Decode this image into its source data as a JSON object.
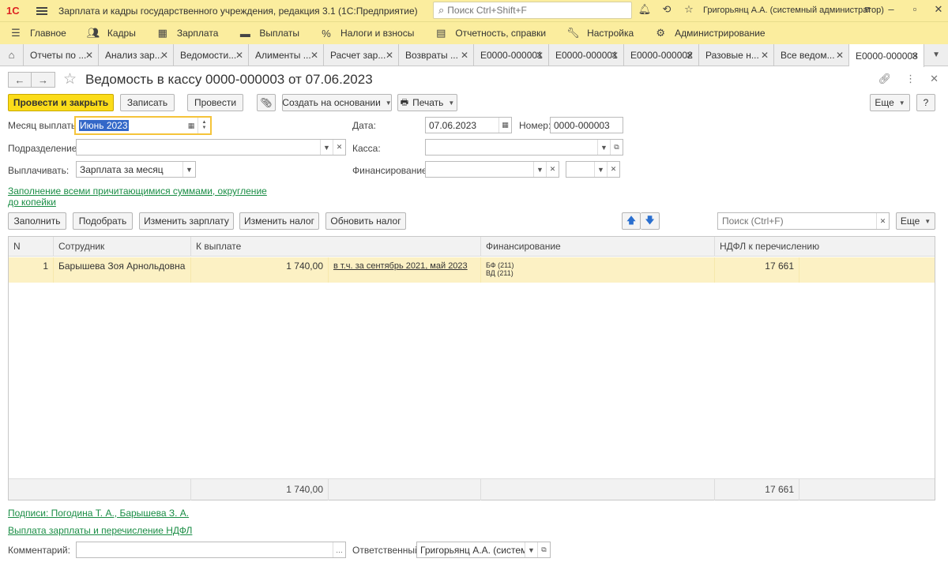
{
  "app": {
    "logo": "1С",
    "title": "Зарплата и кадры государственного учреждения, редакция 3.1  (1С:Предприятие)",
    "search_placeholder": "Поиск Ctrl+Shift+F",
    "user": "Григорьянц А.А. (системный администратор)"
  },
  "menu": [
    {
      "label": "Главное",
      "icon": "list-icon"
    },
    {
      "label": "Кадры",
      "icon": "people-icon"
    },
    {
      "label": "Зарплата",
      "icon": "calculator-icon"
    },
    {
      "label": "Выплаты",
      "icon": "wallet-icon"
    },
    {
      "label": "Налоги и взносы",
      "icon": "percent-icon"
    },
    {
      "label": "Отчетность, справки",
      "icon": "report-icon"
    },
    {
      "label": "Настройка",
      "icon": "wrench-icon"
    },
    {
      "label": "Администрирование",
      "icon": "gear-icon"
    }
  ],
  "tabs": [
    {
      "label": "Отчеты по ..."
    },
    {
      "label": "Анализ зар..."
    },
    {
      "label": "Ведомости..."
    },
    {
      "label": "Алименты ..."
    },
    {
      "label": "Расчет зар..."
    },
    {
      "label": "Возвраты ..."
    },
    {
      "label": "Е0000-000001"
    },
    {
      "label": "Е0000-000001"
    },
    {
      "label": "Е0000-000002"
    },
    {
      "label": "Разовые н..."
    },
    {
      "label": "Все ведом..."
    },
    {
      "label": "Е0000-000003",
      "active": true
    }
  ],
  "doc": {
    "title": "Ведомость в кассу 0000-000003 от 07.06.2023"
  },
  "toolbar": {
    "post_close": "Провести и закрыть",
    "save": "Записать",
    "post": "Провести",
    "create_based": "Создать на основании",
    "print": "Печать",
    "more": "Еще",
    "help": "?"
  },
  "form": {
    "month_label": "Месяц выплаты:",
    "month_value": "Июнь 2023",
    "date_label": "Дата:",
    "date_value": "07.06.2023",
    "number_label": "Номер:",
    "number_value": "0000-000003",
    "division_label": "Подразделение:",
    "division_value": "",
    "cash_label": "Касса:",
    "cash_value": "",
    "pay_label": "Выплачивать:",
    "pay_value": "Зарплата за месяц",
    "financing_label": "Финансирование:",
    "financing_value": "",
    "financing_extra_value": "",
    "fill_link": "Заполнение всеми причитающимися суммами, округление до копейки"
  },
  "table_toolbar": {
    "fill": "Заполнить",
    "pick": "Подобрать",
    "change_salary": "Изменить зарплату",
    "change_tax": "Изменить налог",
    "refresh_tax": "Обновить налог",
    "search_placeholder": "Поиск (Ctrl+F)",
    "more": "Еще"
  },
  "table": {
    "columns": [
      "N",
      "Сотрудник",
      "К выплате",
      "Финансирование",
      "НДФЛ к перечислению"
    ],
    "rows": [
      {
        "n": "1",
        "employee": "Барышева Зоя Арнольдовна",
        "amount": "1 740,00",
        "amount_note": "в т.ч. за сентябрь 2021, май 2023",
        "fin1": "БФ (211)",
        "fin2": "ВД (211)",
        "ndfl": "17 661"
      }
    ],
    "totals": {
      "amount": "1 740,00",
      "ndfl": "17 661"
    }
  },
  "footer": {
    "signatures": "Подписи: Погодина Т. А., Барышева З. А.",
    "payout_link": "Выплата зарплаты и перечисление НДФЛ",
    "comment_label": "Комментарий:",
    "comment_value": "",
    "responsible_label": "Ответственный:",
    "responsible_value": "Григорьянц А.А. (системн"
  }
}
